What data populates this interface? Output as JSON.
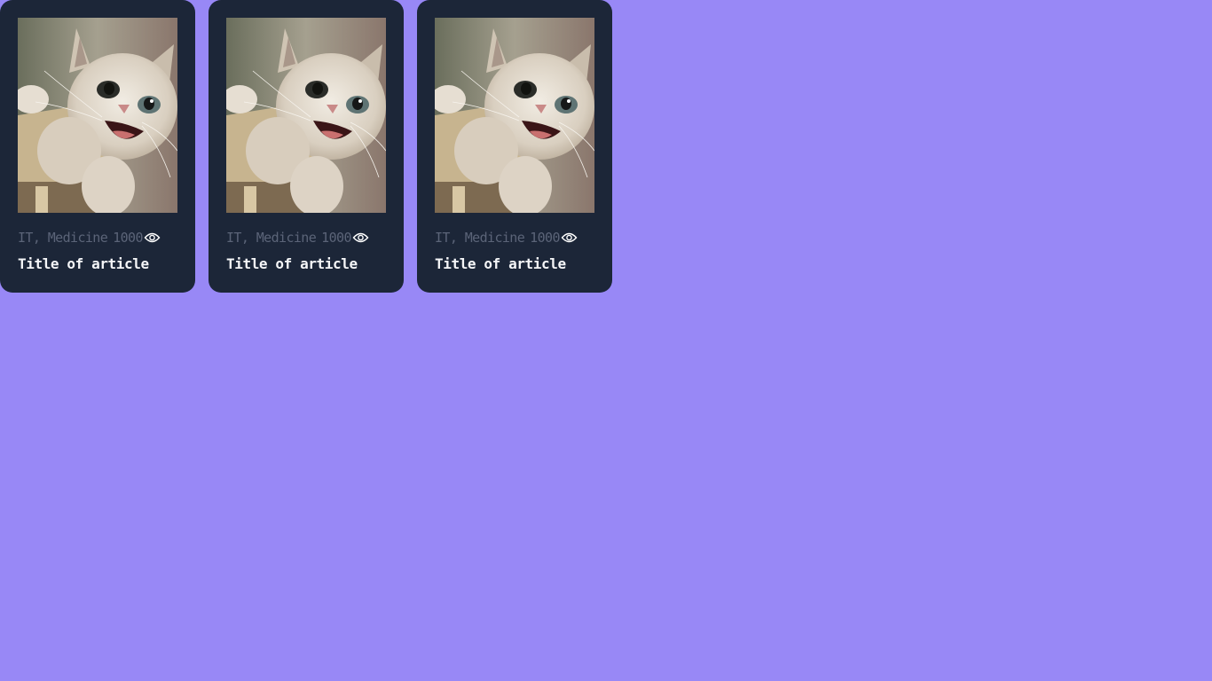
{
  "background_color": "#9888f6",
  "card_color": "#1c2638",
  "cards": [
    {
      "image": "kitten-photo",
      "tags": "IT, Medicine",
      "views": "1000",
      "views_icon": "eye-icon",
      "title": "Title of article"
    },
    {
      "image": "kitten-photo",
      "tags": "IT, Medicine",
      "views": "1000",
      "views_icon": "eye-icon",
      "title": "Title of article"
    },
    {
      "image": "kitten-photo",
      "tags": "IT, Medicine",
      "views": "1000",
      "views_icon": "eye-icon",
      "title": "Title of article"
    }
  ]
}
